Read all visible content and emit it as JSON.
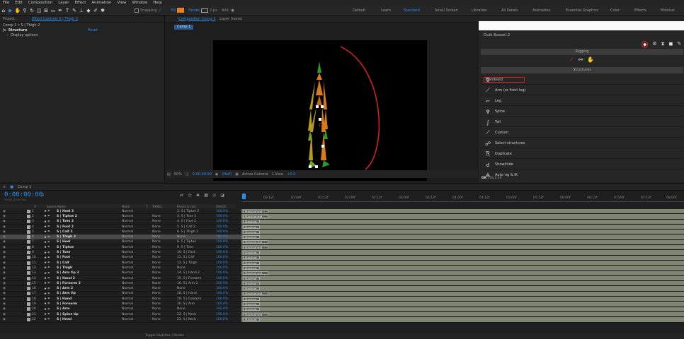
{
  "menu": [
    "File",
    "Edit",
    "Composition",
    "Layer",
    "Effect",
    "Animation",
    "View",
    "Window",
    "Help"
  ],
  "toolbar": {
    "snapping": "Snapping",
    "fill": "Fill",
    "stroke": "Stroke",
    "stroke_px": "2 px",
    "add": "Add:"
  },
  "workspaces": [
    "Default",
    "Learn",
    "Standard",
    "Small Screen",
    "Libraries",
    "All Panels",
    "Animation",
    "Essential Graphics",
    "Color",
    "Effects",
    "Minimal"
  ],
  "left_panel": {
    "tab_project": "Project",
    "tab_effect": "Effect Controls S | Thigh 2",
    "layer_path": "Comp 1 • S | Thigh 2",
    "fx_name": "Structure",
    "reset": "Reset",
    "display_options": "Display options"
  },
  "comp_panel": {
    "tab": "Composition Comp 1",
    "layer_tab": "Layer (none)",
    "comp_btn": "Comp 1",
    "zoom": "50%",
    "timecode": "0:00:00:00",
    "resolution": "(Half)",
    "camera": "Active Camera",
    "view": "1 View",
    "exposure": "+0.0"
  },
  "duik": {
    "title": "Duik Bassel.2",
    "rigging": "Rigging",
    "structures": "Structures",
    "items": [
      "Hominoid",
      "Arm (or front leg)",
      "Leg",
      "Spine",
      "Tail",
      "Custom",
      "Select structures",
      "Duplicate",
      "Show/hide",
      "Auto-rig & IK"
    ],
    "version": "v16.2.30"
  },
  "timeline": {
    "tab": "Comp 1",
    "timecode": "0:00:00:00",
    "fps": "00000 (25.00 fps)",
    "columns": [
      "#",
      "Source Name",
      "Mode",
      "T",
      "TrkMat",
      "Parent & Link",
      "Stretch"
    ],
    "ruler": [
      "0f",
      "00:12f",
      "01:00f",
      "01:12f",
      "02:00f",
      "02:12f",
      "03:00f",
      "03:12f",
      "04:00f",
      "04:12f",
      "05:00f",
      "05:12f",
      "06:00f",
      "06:12f",
      "07:00f",
      "07:12f",
      "08:00f"
    ],
    "footer": "Toggle Switches / Modes",
    "layers": [
      {
        "num": "1",
        "name": "S | Heel 2",
        "mode": "Normal",
        "trk": "",
        "parent": "2. S | Tiptoe 2",
        "stretch": "100.0%",
        "bar": "Structure end"
      },
      {
        "num": "2",
        "name": "S | Tiptoe 2",
        "mode": "Normal",
        "trk": "None",
        "parent": "3. S | Toes 2",
        "stretch": "100.0%",
        "bar": "Structure end"
      },
      {
        "num": "3",
        "name": "S | Toes 2",
        "mode": "Normal",
        "trk": "None",
        "parent": "4. S | Foot 2",
        "stretch": "100.0%",
        "bar": "Structure"
      },
      {
        "num": "4",
        "name": "S | Foot 2",
        "mode": "Normal",
        "trk": "None",
        "parent": "5. S | Calf 2",
        "stretch": "100.0%",
        "bar": "Structure"
      },
      {
        "num": "5",
        "name": "S | Calf 2",
        "mode": "Normal",
        "trk": "None",
        "parent": "6. S | Thigh 2",
        "stretch": "100.0%",
        "bar": "Structure"
      },
      {
        "num": "6",
        "name": "S | Thigh 2",
        "mode": "Normal",
        "trk": "None",
        "parent": "None",
        "stretch": "100.0%",
        "bar": "Structure"
      },
      {
        "num": "7",
        "name": "S | Heel",
        "mode": "Normal",
        "trk": "None",
        "parent": "8. S | Tiptoe",
        "stretch": "100.0%",
        "bar": "Structure end"
      },
      {
        "num": "8",
        "name": "S | Tiptoe",
        "mode": "Normal",
        "trk": "None",
        "parent": "9. S | Toes",
        "stretch": "100.0%",
        "bar": "Structure end"
      },
      {
        "num": "9",
        "name": "S | Toes",
        "mode": "Normal",
        "trk": "None",
        "parent": "10. S | Foot",
        "stretch": "100.0%",
        "bar": "Structure"
      },
      {
        "num": "10",
        "name": "S | Foot",
        "mode": "Normal",
        "trk": "None",
        "parent": "11. S | Calf",
        "stretch": "100.0%",
        "bar": "Structure"
      },
      {
        "num": "11",
        "name": "S | Calf",
        "mode": "Normal",
        "trk": "None",
        "parent": "12. S | Thigh",
        "stretch": "100.0%",
        "bar": "Structure"
      },
      {
        "num": "12",
        "name": "S | Thigh",
        "mode": "Normal",
        "trk": "None",
        "parent": "None",
        "stretch": "100.0%",
        "bar": "Structure"
      },
      {
        "num": "13",
        "name": "S | Arm tip 2",
        "mode": "Normal",
        "trk": "None",
        "parent": "14. S | Hand 2",
        "stretch": "100.0%",
        "bar": "Structure end"
      },
      {
        "num": "14",
        "name": "S | Hand 2",
        "mode": "Normal",
        "trk": "None",
        "parent": "15. S | Forearm",
        "stretch": "100.0%",
        "bar": "Structure"
      },
      {
        "num": "15",
        "name": "S | Forearm 2",
        "mode": "Normal",
        "trk": "None",
        "parent": "16. S | Arm 2",
        "stretch": "100.0%",
        "bar": "Structure"
      },
      {
        "num": "16",
        "name": "S | Arm 2",
        "mode": "Normal",
        "trk": "None",
        "parent": "None",
        "stretch": "100.0%",
        "bar": "Structure"
      },
      {
        "num": "17",
        "name": "S | Arm tip",
        "mode": "Normal",
        "trk": "None",
        "parent": "18. S | Hand",
        "stretch": "100.0%",
        "bar": "Structure end"
      },
      {
        "num": "18",
        "name": "S | Hand",
        "mode": "Normal",
        "trk": "None",
        "parent": "19. S | Forearm",
        "stretch": "100.0%",
        "bar": "Structure"
      },
      {
        "num": "19",
        "name": "S | Forearm",
        "mode": "Normal",
        "trk": "None",
        "parent": "20. S | Arm",
        "stretch": "100.0%",
        "bar": "Structure"
      },
      {
        "num": "20",
        "name": "S | Arm",
        "mode": "Normal",
        "trk": "None",
        "parent": "None",
        "stretch": "100.0%",
        "bar": "Structure"
      },
      {
        "num": "21",
        "name": "S | Spine tip",
        "mode": "Normal",
        "trk": "None",
        "parent": "22. S | Neck",
        "stretch": "100.0%",
        "bar": "Structure end"
      },
      {
        "num": "22",
        "name": "S | Head",
        "mode": "Normal",
        "trk": "None",
        "parent": "23. S | Neck",
        "stretch": "100.0%",
        "bar": "Structure"
      }
    ]
  },
  "colors": {
    "accent": "#2d8ceb",
    "fill": "#e8821e",
    "bar": "#7f8473",
    "highlight_red": "#e02020"
  }
}
